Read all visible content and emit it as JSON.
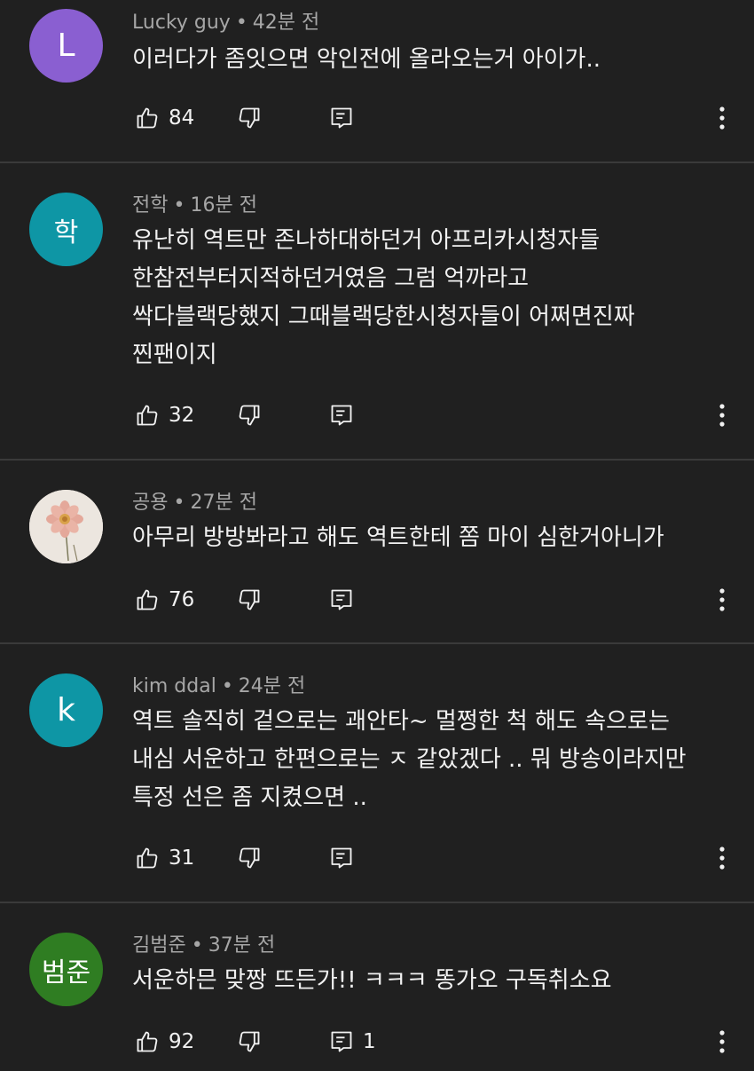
{
  "comments": [
    {
      "avatar_text": "L",
      "avatar_color": "#8a5fd1",
      "author": "Lucky guy",
      "time": "42분 전",
      "lines": [
        "이러다가 좀잇으면 악인전에 올라오는거 아이가.."
      ],
      "likes": "84",
      "replies": ""
    },
    {
      "avatar_text": "학",
      "avatar_color": "#0e96a5",
      "author": "전학",
      "time": "16분 전",
      "lines": [
        "유난히 역트만 존나하대하던거 아프리카시청자들",
        "한참전부터지적하던거였음 그럼 억까라고",
        "싹다블랙당했지 그때블랙당한시청자들이 어쩌면진짜",
        "찐팬이지"
      ],
      "likes": "32",
      "replies": ""
    },
    {
      "avatar_text": "",
      "avatar_icon": "flower-photo",
      "avatar_color": "#ece6df",
      "author": "공용",
      "time": "27분 전",
      "lines": [
        "아무리 방방봐라고 해도 역트한테 쫌 마이 심한거아니가"
      ],
      "likes": "76",
      "replies": ""
    },
    {
      "avatar_text": "k",
      "avatar_color": "#0e96a5",
      "author": "kim ddal",
      "time": "24분 전",
      "lines": [
        "역트 솔직히 겉으로는 괘안타~ 멀쩡한 척 해도 속으로는",
        "내심 서운하고 한편으로는 ㅈ 같았겠다 .. 뭐 방송이라지만",
        "특정 선은 좀 지켰으면 .."
      ],
      "likes": "31",
      "replies": ""
    },
    {
      "avatar_text": "범준",
      "avatar_color": "#2f7d22",
      "author": "김범준",
      "time": "37분 전",
      "lines": [
        "서운하믄 맞짱 뜨든가!! ㅋㅋㅋ 똥가오 구독취소요"
      ],
      "likes": "92",
      "replies": "1"
    }
  ]
}
